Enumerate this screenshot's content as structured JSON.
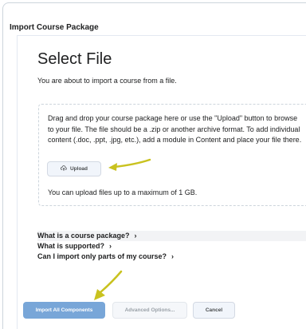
{
  "window": {
    "header": "Import Course Package"
  },
  "main": {
    "title": "Select File",
    "intro": "You are about to import a course from a file.",
    "dropzone": {
      "instructions": "Drag and drop your course package here or use the \"Upload\" button to browse to your file. The file should be a .zip or another archive format. To add individual content (.doc, .ppt, .jpg, etc.), add a module in Content and place your file there.",
      "upload_label": "Upload",
      "upload_icon": "upload-cloud-icon",
      "max_size": "You can upload files up to a maximum of 1 GB."
    },
    "help_links": [
      {
        "label": "What is a course package?",
        "icon": "chevron-right-icon"
      },
      {
        "label": "What is supported?",
        "icon": "chevron-right-icon"
      },
      {
        "label": "Can I import only parts of my course?",
        "icon": "chevron-right-icon"
      }
    ]
  },
  "footer": {
    "import_all_label": "Import All Components",
    "advanced_label": "Advanced Options...",
    "cancel_label": "Cancel"
  },
  "colors": {
    "annotation_arrow": "#c9c21f",
    "primary_button": "#78a6d8"
  }
}
